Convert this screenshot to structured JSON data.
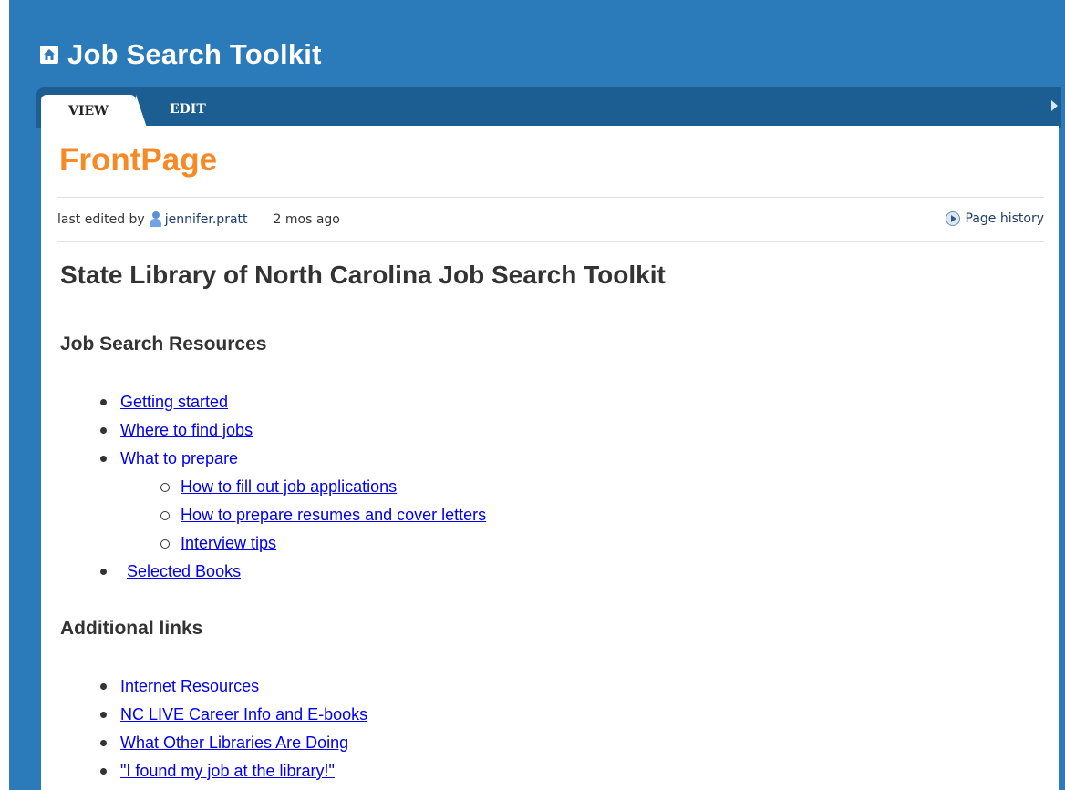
{
  "site": {
    "title": "Job Search Toolkit",
    "home_icon": "home-icon"
  },
  "tabs": [
    {
      "label": "VIEW",
      "active": true
    },
    {
      "label": "EDIT",
      "active": false
    }
  ],
  "page": {
    "title": "FrontPage",
    "meta": {
      "prefix": "last edited by",
      "author": "jennifer.pratt",
      "time": "2 mos ago",
      "history": "Page history"
    }
  },
  "content": {
    "heading": "State Library of North Carolina Job Search Toolkit",
    "section1": {
      "title": "Job Search Resources",
      "items": {
        "getting_started": "Getting started",
        "find_jobs": "Where to find jobs",
        "prepare": "What to prepare",
        "applications": "How to fill out job applications",
        "resumes": "How to prepare resumes and cover letters",
        "interview": "Interview tips",
        "books": "Selected Books"
      }
    },
    "section2": {
      "title": "Additional links",
      "items": [
        "Internet Resources",
        "NC LIVE Career Info and E-books",
        "What Other Libraries Are Doing",
        "\"I found my job at the library!\""
      ]
    }
  },
  "colors": {
    "header_bg": "#2b7bbb",
    "tabbar_bg": "#1c5e92",
    "title_orange": "#f68b26",
    "link": "#0000ee"
  }
}
